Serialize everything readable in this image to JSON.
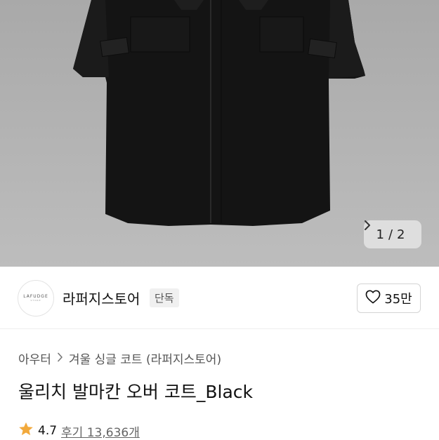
{
  "gallery": {
    "current_page": "1",
    "separator": "/",
    "total_pages": "2",
    "next_icon": "chevron-right-icon"
  },
  "store": {
    "logo_text": "LAFUDGE",
    "logo_subtext": "STORE",
    "name": "라퍼지스토어",
    "badge": "단독",
    "like_icon": "heart-outline-icon",
    "like_count": "35만"
  },
  "product": {
    "breadcrumb": [
      "아우터",
      "겨울 싱글 코트 (라퍼지스토어)"
    ],
    "title": "울리치 발마칸 오버 코트_Black",
    "rating": "4.7",
    "reviews_label": "후기 13,636개",
    "star_color": "#f2a93b"
  }
}
